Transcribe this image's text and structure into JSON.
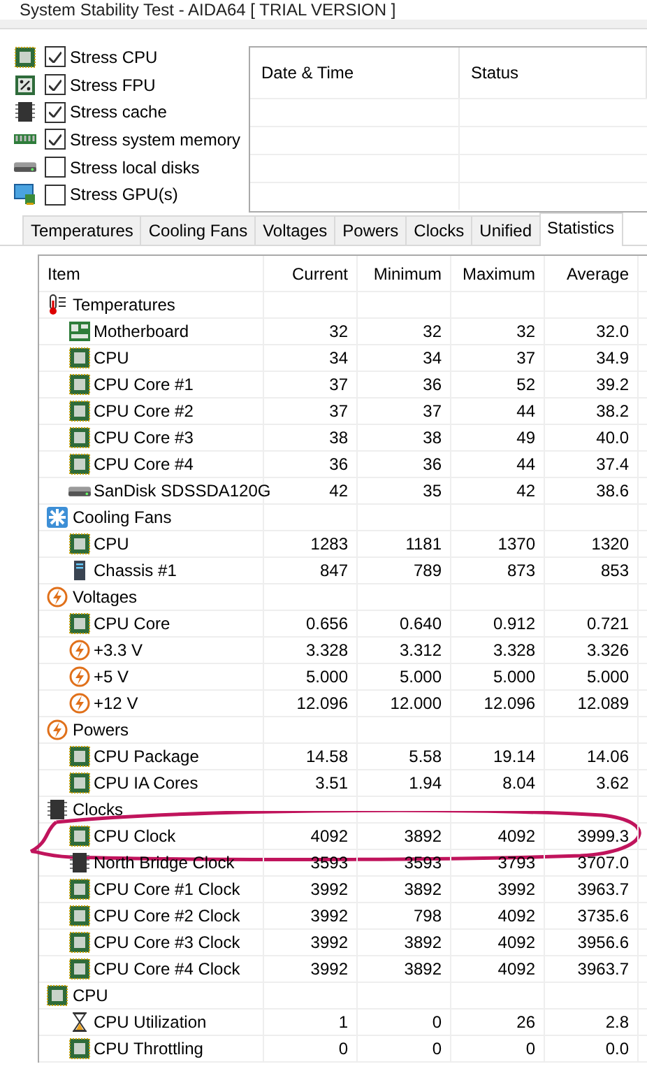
{
  "window": {
    "title": "System Stability Test - AIDA64  [ TRIAL VERSION ]"
  },
  "stress_options": [
    {
      "label": "Stress CPU",
      "checked": true,
      "kind": "cpu"
    },
    {
      "label": "Stress FPU",
      "checked": true,
      "kind": "fpu"
    },
    {
      "label": "Stress cache",
      "checked": true,
      "kind": "cache"
    },
    {
      "label": "Stress system memory",
      "checked": true,
      "kind": "memory"
    },
    {
      "label": "Stress local disks",
      "checked": false,
      "kind": "disk"
    },
    {
      "label": "Stress GPU(s)",
      "checked": false,
      "kind": "gpu"
    }
  ],
  "log": {
    "columns": [
      "Date & Time",
      "Status"
    ]
  },
  "tabs": [
    {
      "label": "Temperatures",
      "selected": false
    },
    {
      "label": "Cooling Fans",
      "selected": false
    },
    {
      "label": "Voltages",
      "selected": false
    },
    {
      "label": "Powers",
      "selected": false
    },
    {
      "label": "Clocks",
      "selected": false
    },
    {
      "label": "Unified",
      "selected": false
    },
    {
      "label": "Statistics",
      "selected": true
    }
  ],
  "table": {
    "columns": [
      "Item",
      "Current",
      "Minimum",
      "Maximum",
      "Average"
    ],
    "groups": [
      {
        "label": "Temperatures",
        "kind": "thermometer",
        "children": [
          {
            "label": "Motherboard",
            "kind": "board",
            "values": [
              "32",
              "32",
              "32",
              "32.0"
            ]
          },
          {
            "label": "CPU",
            "kind": "chip",
            "values": [
              "34",
              "34",
              "37",
              "34.9"
            ]
          },
          {
            "label": "CPU Core #1",
            "kind": "chip",
            "values": [
              "37",
              "36",
              "52",
              "39.2"
            ]
          },
          {
            "label": "CPU Core #2",
            "kind": "chip",
            "values": [
              "37",
              "37",
              "44",
              "38.2"
            ]
          },
          {
            "label": "CPU Core #3",
            "kind": "chip",
            "values": [
              "38",
              "38",
              "49",
              "40.0"
            ]
          },
          {
            "label": "CPU Core #4",
            "kind": "chip",
            "values": [
              "36",
              "36",
              "44",
              "37.4"
            ]
          },
          {
            "label": "SanDisk SDSSDA120G",
            "kind": "disk",
            "values": [
              "42",
              "35",
              "42",
              "38.6"
            ]
          }
        ]
      },
      {
        "label": "Cooling Fans",
        "kind": "fan",
        "children": [
          {
            "label": "CPU",
            "kind": "chip",
            "values": [
              "1283",
              "1181",
              "1370",
              "1320"
            ]
          },
          {
            "label": "Chassis #1",
            "kind": "tower",
            "values": [
              "847",
              "789",
              "873",
              "853"
            ]
          }
        ]
      },
      {
        "label": "Voltages",
        "kind": "bolt",
        "children": [
          {
            "label": "CPU Core",
            "kind": "chip",
            "values": [
              "0.656",
              "0.640",
              "0.912",
              "0.721"
            ]
          },
          {
            "label": "+3.3 V",
            "kind": "bolt",
            "values": [
              "3.328",
              "3.312",
              "3.328",
              "3.326"
            ]
          },
          {
            "label": "+5 V",
            "kind": "bolt",
            "values": [
              "5.000",
              "5.000",
              "5.000",
              "5.000"
            ]
          },
          {
            "label": "+12 V",
            "kind": "bolt",
            "values": [
              "12.096",
              "12.000",
              "12.096",
              "12.089"
            ]
          }
        ]
      },
      {
        "label": "Powers",
        "kind": "bolt",
        "children": [
          {
            "label": "CPU Package",
            "kind": "chip",
            "values": [
              "14.58",
              "5.58",
              "19.14",
              "14.06"
            ]
          },
          {
            "label": "CPU IA Cores",
            "kind": "chip",
            "values": [
              "3.51",
              "1.94",
              "8.04",
              "3.62"
            ]
          }
        ]
      },
      {
        "label": "Clocks",
        "kind": "memchip",
        "children": [
          {
            "label": "CPU Clock",
            "kind": "chip",
            "circled": true,
            "values": [
              "4092",
              "3892",
              "4092",
              "3999.3"
            ]
          },
          {
            "label": "North Bridge Clock",
            "kind": "memchip",
            "circled": false,
            "values": [
              "3593",
              "3593",
              "3793",
              "3707.0"
            ]
          },
          {
            "label": "CPU Core #1 Clock",
            "kind": "chip",
            "circled": false,
            "values": [
              "3992",
              "3892",
              "3992",
              "3963.7"
            ]
          },
          {
            "label": "CPU Core #2 Clock",
            "kind": "chip",
            "circled": false,
            "values": [
              "3992",
              "798",
              "4092",
              "3735.6"
            ]
          },
          {
            "label": "CPU Core #3 Clock",
            "kind": "chip",
            "circled": false,
            "values": [
              "3992",
              "3892",
              "4092",
              "3956.6"
            ]
          },
          {
            "label": "CPU Core #4 Clock",
            "kind": "chip",
            "circled": false,
            "values": [
              "3992",
              "3892",
              "4092",
              "3963.7"
            ]
          }
        ]
      },
      {
        "label": "CPU",
        "kind": "chip",
        "children": [
          {
            "label": "CPU Utilization",
            "kind": "hourglass",
            "values": [
              "1",
              "0",
              "26",
              "2.8"
            ]
          },
          {
            "label": "CPU Throttling",
            "kind": "chip",
            "values": [
              "0",
              "0",
              "0",
              "0.0"
            ]
          }
        ]
      }
    ]
  }
}
